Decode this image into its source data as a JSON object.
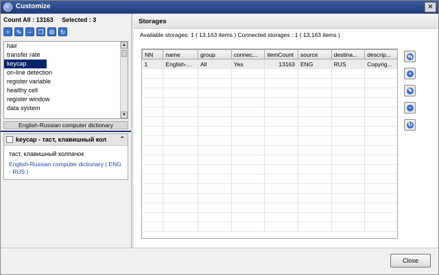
{
  "window": {
    "title": "Customize",
    "close_glyph": "✕"
  },
  "counts": {
    "all": "Count All : 13163",
    "selected": "Selected : 3"
  },
  "toolbar": {
    "buttons": [
      {
        "icon": "add-icon",
        "glyph": "+"
      },
      {
        "icon": "edit-icon",
        "glyph": "✎"
      },
      {
        "icon": "remove-icon",
        "glyph": "−"
      },
      {
        "icon": "copy-icon",
        "glyph": "❐"
      },
      {
        "icon": "settings-icon",
        "glyph": "⚙"
      },
      {
        "icon": "refresh-icon",
        "glyph": "↻"
      }
    ]
  },
  "word_list": {
    "items": [
      "hair",
      "transfer rate",
      "keycap",
      "on-line detection",
      "register variable",
      "healthy cell",
      "register window",
      "data system"
    ],
    "selected_index": 2
  },
  "dictionary_bar": "English-Russian computer dictionary",
  "detail": {
    "word": "keycap - таст, клавишный кол",
    "collapse_glyph": "⌃",
    "translation": "таст, клавишный колпачок",
    "source": "English-Russian computer dictionary ( ENG - RUS )"
  },
  "storages": {
    "title": "Storages",
    "info": "Available storages: 1  ( 13,163  items )   Connected storages :  1  ( 13,163  items )",
    "columns": [
      "NN",
      "name",
      "group",
      "connec...",
      "itemCount",
      "source",
      "destina...",
      "descrip..."
    ],
    "rows": [
      [
        "1",
        "English-...",
        "All",
        "Yes",
        "13163",
        "ENG",
        "RUS",
        "Copyrig..."
      ]
    ]
  },
  "side_buttons": [
    {
      "icon": "connect-icon",
      "glyph": "⇆"
    },
    {
      "icon": "add-icon",
      "glyph": "+"
    },
    {
      "icon": "edit-icon",
      "glyph": "✎"
    },
    {
      "icon": "remove-icon",
      "glyph": "−"
    },
    {
      "icon": "refresh-icon",
      "glyph": "↻"
    }
  ],
  "footer": {
    "close_label": "Close"
  }
}
